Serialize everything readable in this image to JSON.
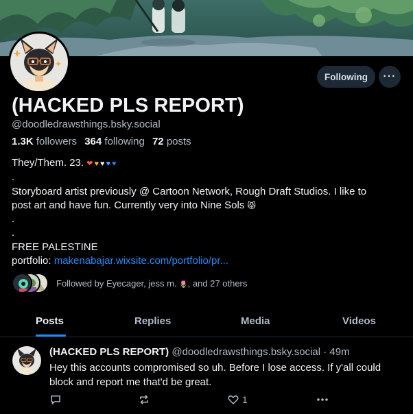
{
  "profile": {
    "display_name": "(HACKED PLS REPORT)",
    "handle": "@doodledrawsthings.bsky.social",
    "followers_count": "1.3K",
    "followers_label": "followers",
    "following_count": "364",
    "following_label": "following",
    "posts_count": "72",
    "posts_label": "posts"
  },
  "buttons": {
    "following": "Following",
    "more": "···"
  },
  "bio": {
    "line1": "They/Them. 23.",
    "hearts": [
      "❤",
      "♥",
      "♥",
      "♥",
      "♥"
    ],
    "heart_colors": [
      "#f0603a",
      "#f6b52a",
      "#e9e0ff",
      "#49a6f3",
      "#2f7ae5"
    ],
    "dot1": ".",
    "line2": "Storyboard artist previously @ Cartoon Network, Rough Draft Studios. I like to",
    "line3": "post art and have fun. Currently very into Nine Sols",
    "cat_emoji": "😾",
    "dot2": ".",
    "dot3": ".",
    "line4": "FREE PALESTINE",
    "portfolio_label": "portfolio:",
    "portfolio_link": "makenabajar.wixsite.com/portfolio/pr..."
  },
  "followed_by": {
    "text": "Followed by Eyecager, jess m.",
    "emoji": "🌷",
    "suffix": ", and 27 others"
  },
  "tabs": [
    "Posts",
    "Replies",
    "Media",
    "Videos"
  ],
  "post": {
    "author_name": "(HACKED PLS REPORT)",
    "author_handle": "@doodledrawsthings.bsky.social",
    "separator": "·",
    "time": "49m",
    "text_line1": "Hey this accounts compromised so uh. Before I lose access. If y'all could",
    "text_line2": "block and report me that'd be great.",
    "like_count": "1"
  },
  "colors": {
    "background": "#000000",
    "accent": "#208bfe",
    "muted_text": "#aebbc9",
    "button_bg": "#1e2936"
  },
  "icons": {
    "reply": "speech-bubble-icon",
    "repost": "repost-arrows-icon",
    "like": "heart-outline-icon",
    "more": "ellipsis-icon"
  }
}
